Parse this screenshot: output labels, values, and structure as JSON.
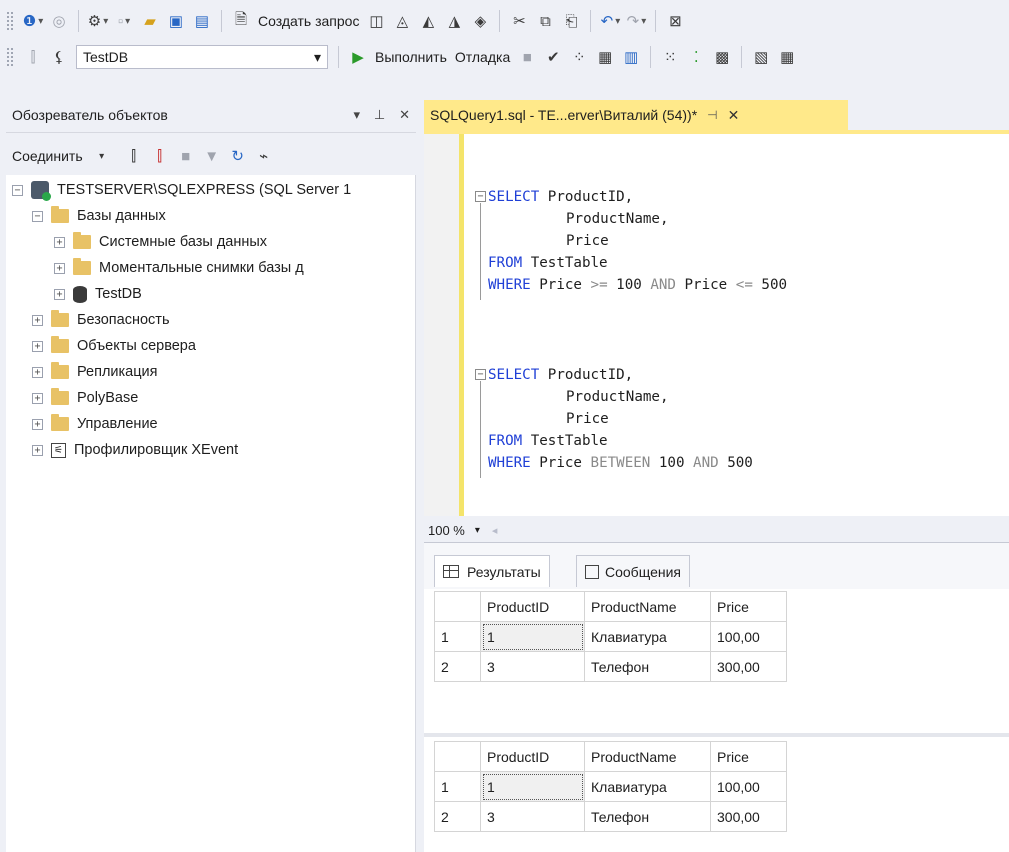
{
  "toolbar1": {
    "new_query": "Создать запрос",
    "mdx": "MDX",
    "dmx": "DMX",
    "xmla": "XMLA",
    "dax": "DAX"
  },
  "toolbar2": {
    "database": "TestDB",
    "execute": "Выполнить",
    "debug": "Отладка"
  },
  "object_explorer": {
    "title": "Обозреватель объектов",
    "connect": "Соединить",
    "tree": {
      "server": "TESTSERVER\\SQLEXPRESS (SQL Server 1",
      "databases": "Базы данных",
      "system_dbs": "Системные базы данных",
      "snapshots": "Моментальные снимки базы д",
      "testdb": "TestDB",
      "security": "Безопасность",
      "server_objects": "Объекты сервера",
      "replication": "Репликация",
      "polybase": "PolyBase",
      "management": "Управление",
      "xevent": "Профилировщик XEvent"
    }
  },
  "editor": {
    "tab_title": "SQLQuery1.sql - TE...erver\\Виталий (54))*",
    "zoom": "100 %",
    "q1": {
      "select": "SELECT",
      "col1": "ProductID,",
      "col2": "ProductName,",
      "col3": "Price",
      "from": "FROM",
      "table": "TestTable",
      "where": "WHERE",
      "c1": "Price",
      "ge": ">=",
      "v1": "100",
      "and": "AND",
      "c2": "Price",
      "le": "<=",
      "v2": "500"
    },
    "q2": {
      "select": "SELECT",
      "col1": "ProductID,",
      "col2": "ProductName,",
      "col3": "Price",
      "from": "FROM",
      "table": "TestTable",
      "where": "WHERE",
      "c1": "Price",
      "between": "BETWEEN",
      "v1": "100",
      "and": "AND",
      "v2": "500"
    }
  },
  "results": {
    "tab_results": "Результаты",
    "tab_messages": "Сообщения",
    "columns": [
      "ProductID",
      "ProductName",
      "Price"
    ],
    "grid1": [
      {
        "row": "1",
        "ProductID": "1",
        "ProductName": "Клавиатура",
        "Price": "100,00"
      },
      {
        "row": "2",
        "ProductID": "3",
        "ProductName": "Телефон",
        "Price": "300,00"
      }
    ],
    "grid2": [
      {
        "row": "1",
        "ProductID": "1",
        "ProductName": "Клавиатура",
        "Price": "100,00"
      },
      {
        "row": "2",
        "ProductID": "3",
        "ProductName": "Телефон",
        "Price": "300,00"
      }
    ]
  }
}
